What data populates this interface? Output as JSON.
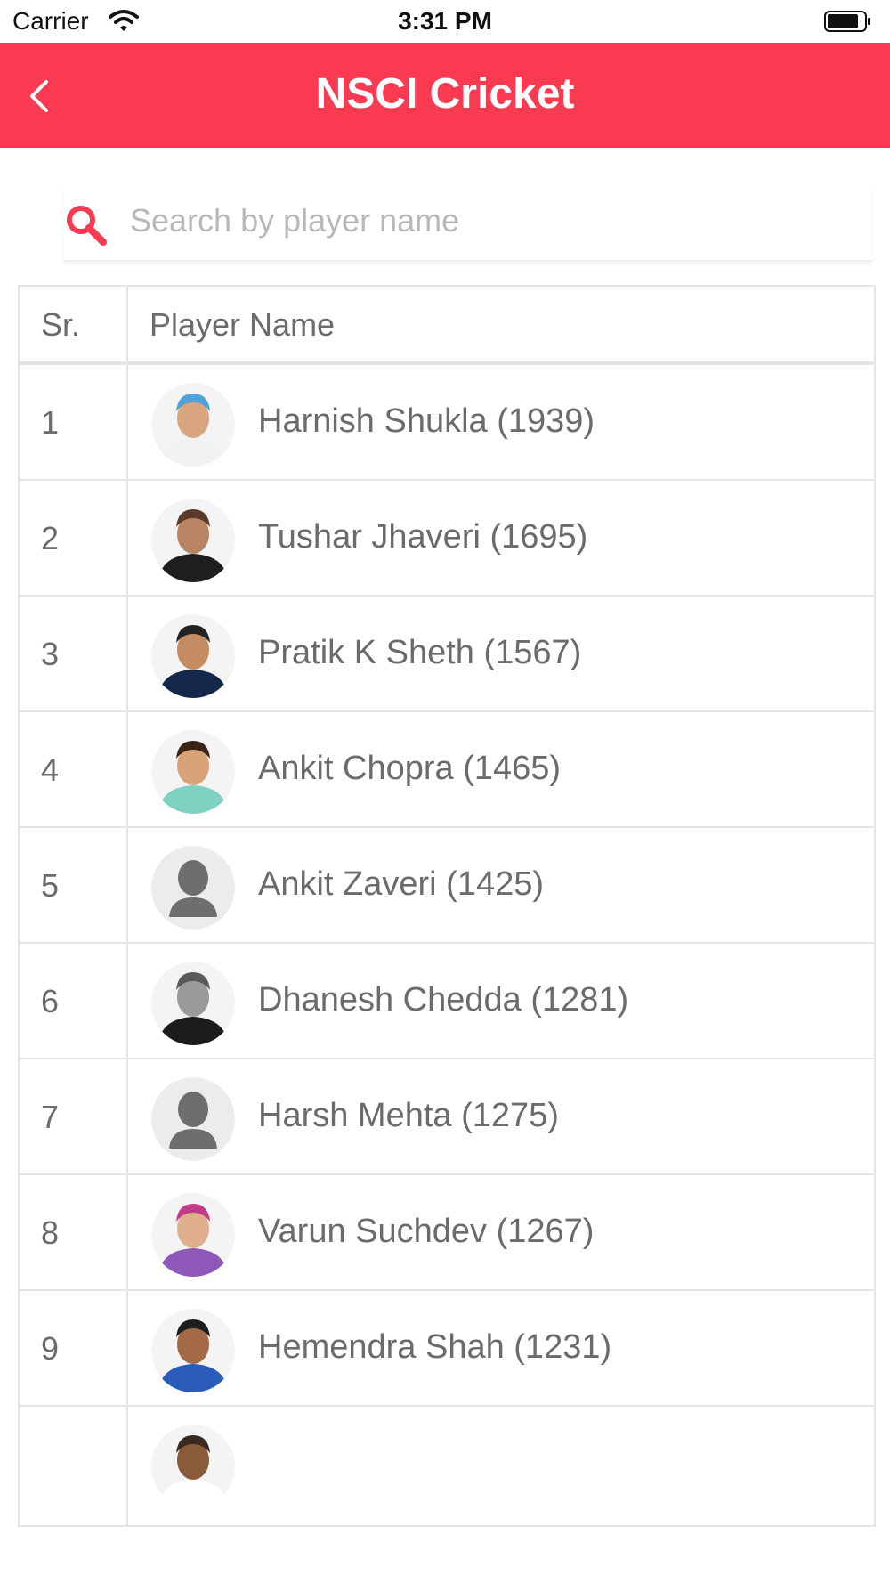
{
  "status_bar": {
    "carrier": "Carrier",
    "time": "3:31 PM"
  },
  "nav": {
    "title": "NSCI Cricket",
    "back_icon": "chevron-left-icon"
  },
  "search": {
    "placeholder": "Search by player name",
    "value": "",
    "icon": "search-icon"
  },
  "colors": {
    "accent": "#f93a50",
    "border": "#e4e4e4",
    "text": "#6b6b6b",
    "placeholder": "#b8b8b8"
  },
  "table": {
    "headers": {
      "sr": "Sr.",
      "name": "Player Name"
    },
    "rows": [
      {
        "sr": "1",
        "name": "Harnish Shukla (1939)",
        "avatar": "photo",
        "skin": "#d9a57e",
        "top": "#4fa3d8",
        "bottom": "#f2f2f2"
      },
      {
        "sr": "2",
        "name": "Tushar Jhaveri (1695)",
        "avatar": "photo",
        "skin": "#b98464",
        "top": "#5a3b2b",
        "bottom": "#1e1e1e"
      },
      {
        "sr": "3",
        "name": "Pratik K Sheth (1567)",
        "avatar": "photo",
        "skin": "#c58b62",
        "top": "#232323",
        "bottom": "#13284a"
      },
      {
        "sr": "4",
        "name": "Ankit Chopra (1465)",
        "avatar": "photo",
        "skin": "#d9a278",
        "top": "#3b2416",
        "bottom": "#7fd0c1"
      },
      {
        "sr": "5",
        "name": "Ankit Zaveri (1425)",
        "avatar": "placeholder"
      },
      {
        "sr": "6",
        "name": "Dhanesh Chedda (1281)",
        "avatar": "photo",
        "skin": "#9a9a9a",
        "top": "#5a5a5a",
        "bottom": "#1c1c1c"
      },
      {
        "sr": "7",
        "name": "Harsh Mehta (1275)",
        "avatar": "placeholder"
      },
      {
        "sr": "8",
        "name": "Varun Suchdev (1267)",
        "avatar": "photo",
        "skin": "#e0b08e",
        "top": "#c23b8a",
        "bottom": "#8e58b8"
      },
      {
        "sr": "9",
        "name": "Hemendra Shah (1231)",
        "avatar": "photo",
        "skin": "#a36a45",
        "top": "#1d1d1d",
        "bottom": "#2a5bb8"
      },
      {
        "sr": "",
        "name": "",
        "avatar": "photo",
        "skin": "#8a5b3b",
        "top": "#3a2a1f",
        "bottom": "#ffffff"
      }
    ]
  }
}
